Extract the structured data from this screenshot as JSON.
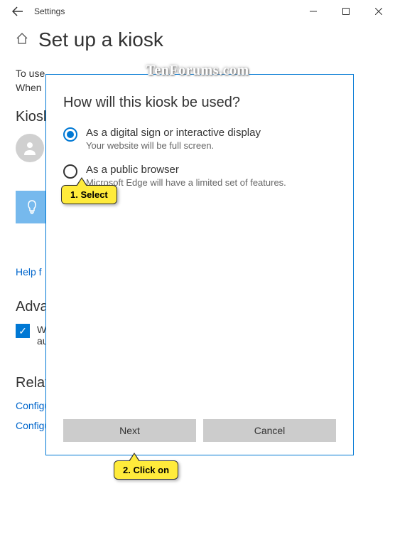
{
  "titlebar": {
    "title": "Settings"
  },
  "page": {
    "title": "Set up a kiosk",
    "intro_line1": "To use",
    "intro_line2": "When"
  },
  "sections": {
    "kiosk_heading": "Kiosk",
    "help_link": "Help f",
    "advanced_heading": "Advanced",
    "checkbox_line1": "W",
    "checkbox_line2": "au",
    "related_heading": "Related settings",
    "link_power": "Configure power and sleep settings",
    "link_hours": "Configure active hours"
  },
  "dialog": {
    "title": "How will this kiosk be used?",
    "options": [
      {
        "label": "As a digital sign or interactive display",
        "desc": "Your website will be full screen.",
        "selected": true
      },
      {
        "label": "As a public browser",
        "desc": "Microsoft Edge will have a limited set of features.",
        "selected": false
      }
    ],
    "next": "Next",
    "cancel": "Cancel"
  },
  "callouts": {
    "c1": "1. Select",
    "c2": "2. Click on"
  },
  "watermark": "TenForums.com"
}
